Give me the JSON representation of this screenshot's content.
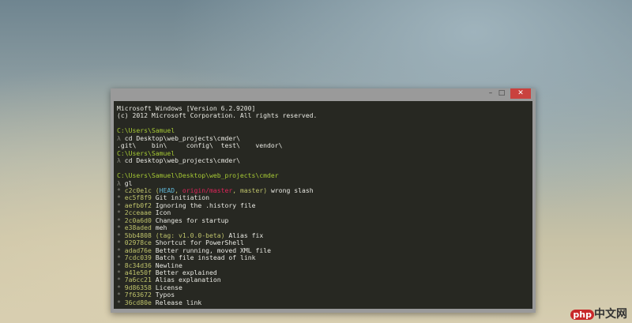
{
  "window": {
    "minimize": "–",
    "maximize": "□",
    "close": "✕"
  },
  "header": [
    "Microsoft Windows [Version 6.2.9200]",
    "(c) 2012 Microsoft Corporation. All rights reserved."
  ],
  "session1": {
    "prompt": "C:\\Users\\Samuel",
    "cmd": "cd Desktop\\web_projects\\cmder\\",
    "completion": ".git\\    bin\\     config\\  test\\    vendor\\"
  },
  "session2": {
    "prompt": "C:\\Users\\Samuel",
    "cmd": "cd Desktop\\web_projects\\cmder\\"
  },
  "session3": {
    "prompt": "C:\\Users\\Samuel\\Desktop\\web_projects\\cmder",
    "cmd": "gl"
  },
  "lambda": "λ",
  "bullet": "*",
  "first_commit": {
    "hash": "c2c0e1c",
    "head": "HEAD",
    "origin": "origin/master",
    "master": "master",
    "msg": "wrong slash"
  },
  "tag_commit": {
    "hash": "5bb4808",
    "tag": "(tag: v1.0.0-beta)",
    "msg": "Alias fix"
  },
  "commits": [
    {
      "hash": "ec5f8f9",
      "msg": "Git initiation"
    },
    {
      "hash": "aefb0f2",
      "msg": "Ignoring the .history file"
    },
    {
      "hash": "2cceaae",
      "msg": "Icon"
    },
    {
      "hash": "2c0a6d0",
      "msg": "Changes for startup"
    },
    {
      "hash": "e38aded",
      "msg": "meh"
    }
  ],
  "commits2": [
    {
      "hash": "02978ce",
      "msg": "Shortcut for PowerShell"
    },
    {
      "hash": "adad76e",
      "msg": "Better running, moved XML file"
    },
    {
      "hash": "7cdc039",
      "msg": "Batch file instead of link"
    },
    {
      "hash": "8c34d36",
      "msg": "Newline"
    },
    {
      "hash": "a41e50f",
      "msg": "Better explained"
    },
    {
      "hash": "7a6cc21",
      "msg": "Alias explanation"
    },
    {
      "hash": "9d86358",
      "msg": "License"
    },
    {
      "hash": "7f63672",
      "msg": "Typos"
    },
    {
      "hash": "36cd80e",
      "msg": "Release link"
    }
  ],
  "watermark": {
    "php": "php",
    "text": "中文网"
  }
}
